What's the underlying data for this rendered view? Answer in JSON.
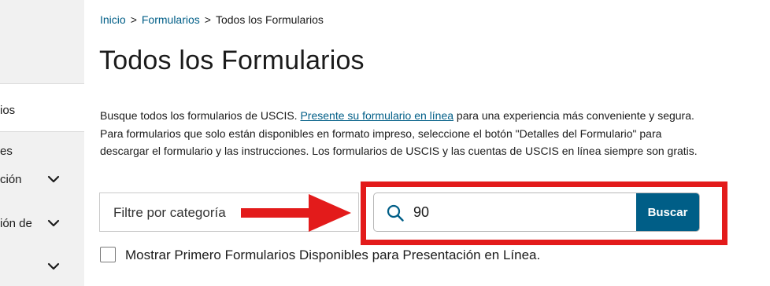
{
  "sidebar": {
    "items": [
      {
        "label": "ios",
        "expandable": false,
        "active": true
      },
      {
        "label": "es",
        "expandable": false
      },
      {
        "label": "ción",
        "expandable": true
      },
      {
        "label": "ión de",
        "expandable": true
      },
      {
        "label": "",
        "expandable": true
      }
    ]
  },
  "breadcrumb": {
    "home": "Inicio",
    "sep": ">",
    "forms": "Formularios",
    "current": "Todos los Formularios"
  },
  "page": {
    "title": "Todos los Formularios",
    "desc_before": "Busque todos los formularios de USCIS. ",
    "desc_link": "Presente su formulario en línea",
    "desc_after": " para una experiencia más conveniente y segura. Para formularios que solo están disponibles en formato impreso, seleccione el botón \"Detalles del Formulario\" para descargar el formulario y las instrucciones. Los formularios de USCIS y las cuentas de USCIS en línea siempre son gratis."
  },
  "filter": {
    "category_placeholder": "Filtre por categoría"
  },
  "search": {
    "value": "90",
    "button_label": "Buscar"
  },
  "checkbox": {
    "label": "Mostrar Primero Formularios Disponibles para Presentación en Línea.",
    "checked": false
  },
  "colors": {
    "link": "#005e87",
    "button": "#005e87",
    "highlight": "#e31b1b",
    "sidebar_bg": "#f1f1f1"
  },
  "icons": {
    "search": "search-icon",
    "chevron": "chevron-down-icon"
  }
}
